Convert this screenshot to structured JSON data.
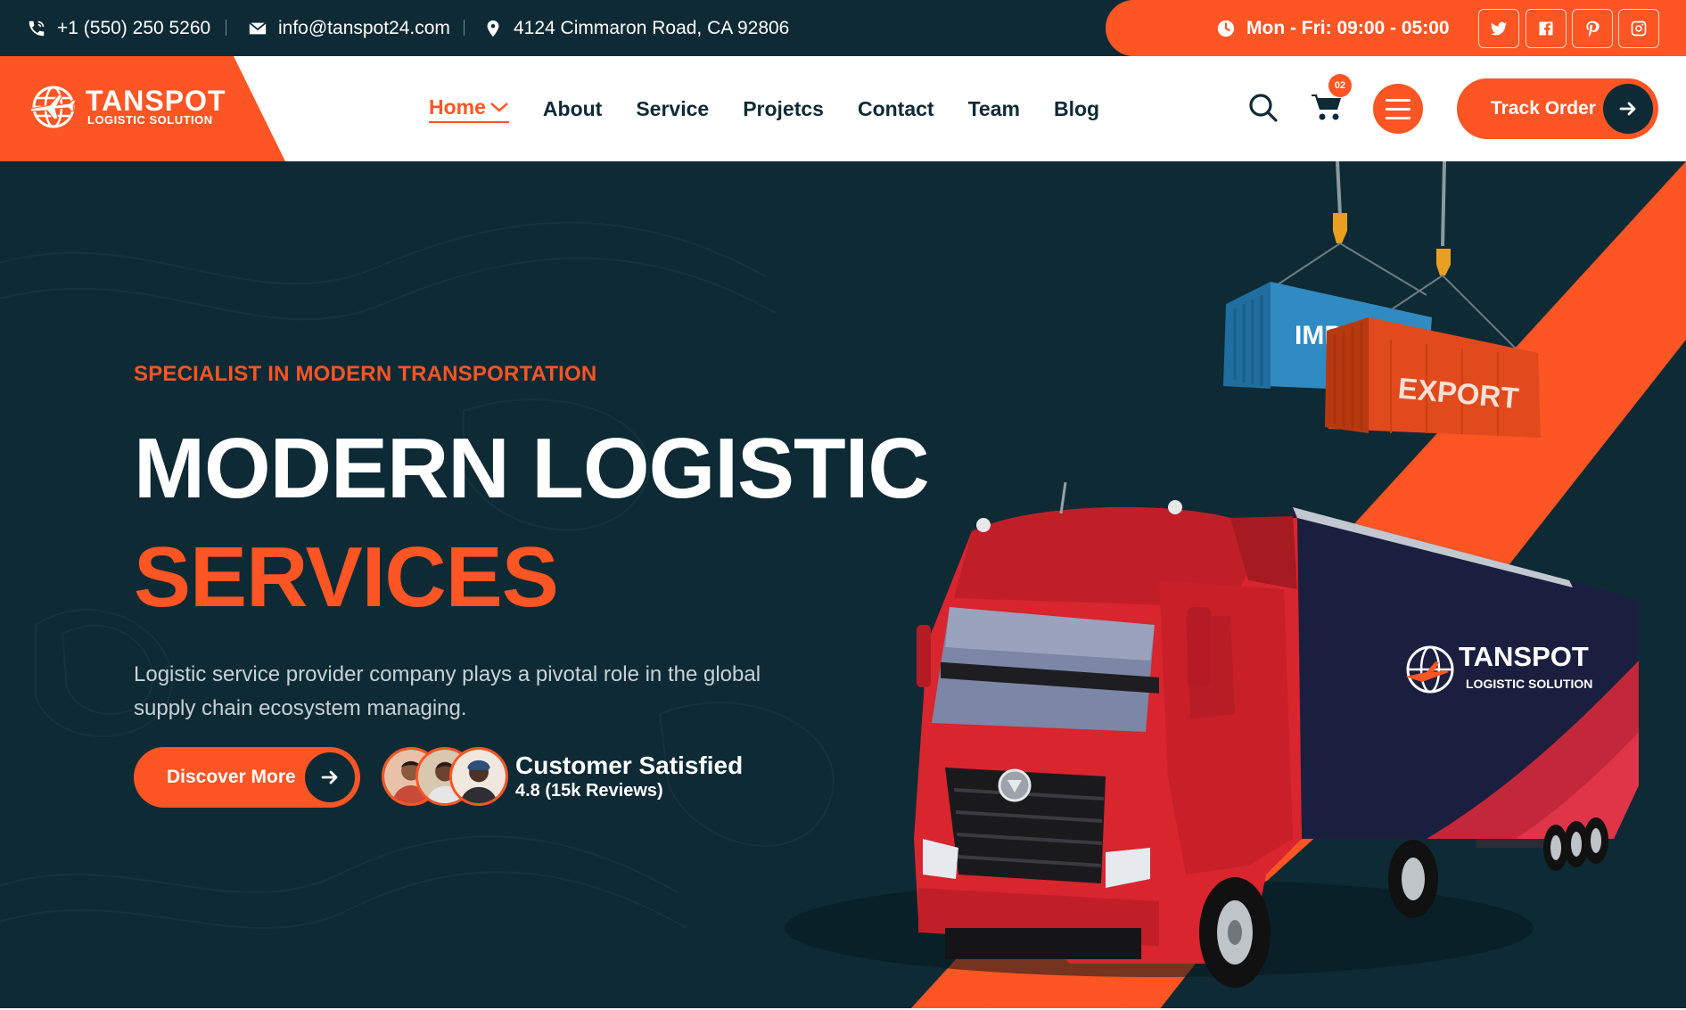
{
  "topbar": {
    "phone": "+1 (550) 250 5260",
    "email": "info@tanspot24.com",
    "address": "4124 Cimmaron Road, CA 92806",
    "hours": "Mon - Fri: 09:00 - 05:00",
    "social_icons": [
      "twitter-icon",
      "facebook-icon",
      "pinterest-icon",
      "instagram-icon"
    ]
  },
  "brand": {
    "name": "TANSPOT",
    "tagline": "LOGISTIC SOLUTION"
  },
  "nav": {
    "items": [
      {
        "label": "Home",
        "active": true
      },
      {
        "label": "About"
      },
      {
        "label": "Service"
      },
      {
        "label": "Projetcs"
      },
      {
        "label": "Contact"
      },
      {
        "label": "Team"
      },
      {
        "label": "Blog"
      }
    ],
    "cart_count": "02",
    "track_label": "Track Order"
  },
  "hero": {
    "kicker": "SPECIALIST IN MODERN TRANSPORTATION",
    "title_line1": "MODERN LOGISTIC",
    "title_line2": "SERVICES",
    "description": "Logistic service provider company plays a pivotal role in the global supply chain ecosystem managing.",
    "cta_label": "Discover More",
    "satisfaction_title": "Customer Satisfied",
    "satisfaction_rating": "4.8 (15k Reviews)",
    "container_import_label": "IMP",
    "container_export_label": "EXPORT",
    "trailer_brand": "TANSPOT",
    "trailer_tagline": "LOGISTIC SOLUTION"
  },
  "colors": {
    "accent": "#fd5523",
    "dark": "#0e2a35",
    "white": "#ffffff"
  }
}
